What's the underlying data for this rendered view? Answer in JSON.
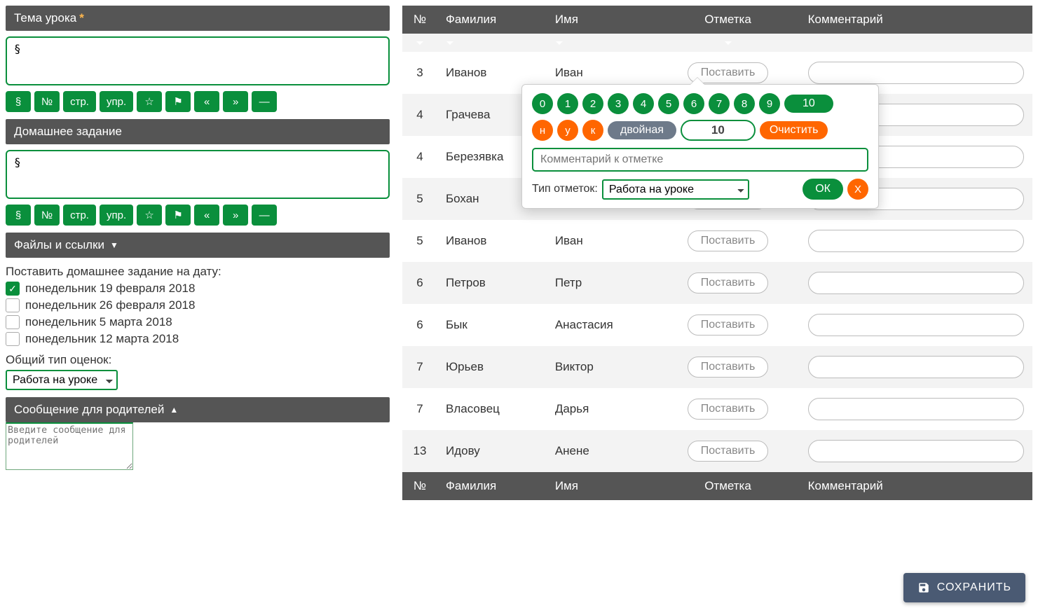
{
  "left": {
    "topic_header": "Тема урока",
    "topic_value": "§",
    "hw_header": "Домашнее задание",
    "hw_value": "§",
    "files_header": "Файлы и ссылки",
    "toolbar": [
      "§",
      "№",
      "стр.",
      "упр.",
      "☆",
      "⚑",
      "«",
      "»",
      "—"
    ],
    "hw_date_label": "Поставить домашнее задание на дату:",
    "dates": [
      {
        "label": "понедельник 19 февраля 2018",
        "checked": true
      },
      {
        "label": "понедельник 26 февраля 2018",
        "checked": false
      },
      {
        "label": "понедельник 5 марта 2018",
        "checked": false
      },
      {
        "label": "понедельник 12 марта 2018",
        "checked": false
      }
    ],
    "grade_type_label": "Общий тип оценок:",
    "grade_type_value": "Работа на уроке",
    "parents_header": "Сообщение для родителей",
    "parents_placeholder": "Введите сообщение для родителей"
  },
  "table": {
    "cols": [
      "№",
      "Фамилия",
      "Имя",
      "Отметка",
      "Комментарий"
    ],
    "set_label": "Поставить",
    "rows": [
      {
        "n": "3",
        "last": "Иванов",
        "first": "Иван"
      },
      {
        "n": "4",
        "last": "Грачева",
        "first": ""
      },
      {
        "n": "4",
        "last": "Березявка",
        "first": ""
      },
      {
        "n": "5",
        "last": "Бохан",
        "first": ""
      },
      {
        "n": "5",
        "last": "Иванов",
        "first": "Иван"
      },
      {
        "n": "6",
        "last": "Петров",
        "first": "Петр"
      },
      {
        "n": "6",
        "last": "Бык",
        "first": "Анастасия"
      },
      {
        "n": "7",
        "last": "Юрьев",
        "first": "Виктор"
      },
      {
        "n": "7",
        "last": "Власовец",
        "first": "Дарья"
      },
      {
        "n": "13",
        "last": "Идову",
        "first": "Анене"
      }
    ]
  },
  "pop": {
    "nums": [
      "0",
      "1",
      "2",
      "3",
      "4",
      "5",
      "6",
      "7",
      "8",
      "9"
    ],
    "ten": "10",
    "letters": [
      "н",
      "у",
      "к"
    ],
    "double": "двойная",
    "value": "10",
    "clear": "Очистить",
    "comment_ph": "Комментарий к отметке",
    "type_label": "Тип отметок:",
    "type_value": "Работа на уроке",
    "ok": "ОК",
    "x": "X"
  },
  "save": "СОХРАНИТЬ"
}
